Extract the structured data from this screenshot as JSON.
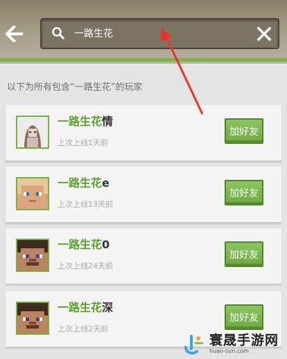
{
  "header": {
    "back_icon": "arrow-left-icon",
    "search_icon": "search-icon",
    "clear_icon": "close-icon"
  },
  "search": {
    "query": "一路生花"
  },
  "results": {
    "caption": "以下为所有包含“一路生花”的玩家",
    "players": [
      {
        "name_match": "一路生花",
        "name_suffix": "情",
        "last_seen": "上次上线1天前",
        "add_label": "加好友"
      },
      {
        "name_match": "一路生花",
        "name_suffix": "e",
        "last_seen": "上次上线13天前",
        "add_label": "加好友"
      },
      {
        "name_match": "一路生花",
        "name_suffix": "0",
        "last_seen": "上次上线24天前",
        "add_label": "加好友"
      },
      {
        "name_match": "一路生花",
        "name_suffix": "深",
        "last_seen": "上次上线2天前",
        "add_label": "加好友"
      }
    ]
  },
  "watermark": {
    "main": "寰晟手游网",
    "sub": "huan-sun.com"
  },
  "colors": {
    "accent": "#6da93f",
    "header_bg": "#a39a86",
    "arrow": "#e8342a"
  }
}
